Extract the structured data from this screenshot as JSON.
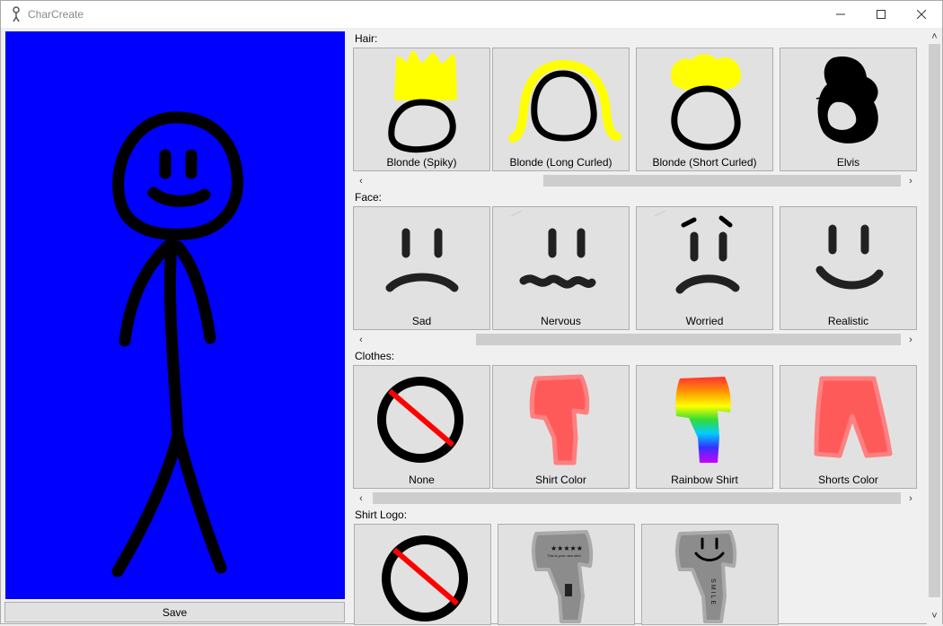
{
  "window": {
    "title": "CharCreate"
  },
  "preview": {
    "background_color": "#0000ff"
  },
  "save_label": "Save",
  "sections": {
    "hair": {
      "label": "Hair:",
      "items": [
        {
          "label": "Blonde (Spiky)"
        },
        {
          "label": "Blonde (Long Curled)"
        },
        {
          "label": "Blonde (Short Curled)"
        },
        {
          "label": "Elvis"
        }
      ]
    },
    "face": {
      "label": "Face:",
      "items": [
        {
          "label": "Sad"
        },
        {
          "label": "Nervous"
        },
        {
          "label": "Worried"
        },
        {
          "label": "Realistic"
        }
      ]
    },
    "clothes": {
      "label": "Clothes:",
      "items": [
        {
          "label": "None"
        },
        {
          "label": "Shirt Color"
        },
        {
          "label": "Rainbow Shirt"
        },
        {
          "label": "Shorts Color"
        }
      ]
    },
    "logo": {
      "label": "Shirt Logo:",
      "items": [
        {
          "label": ""
        },
        {
          "label": ""
        },
        {
          "label": ""
        }
      ],
      "logo_stars_text": "★★★★★",
      "logo_small_text": "This is your new shirt",
      "logo_smile_text": "SMILE"
    }
  },
  "colors": {
    "blonde": "#ffff00",
    "shirt": "#ff5a5a",
    "logo_shirt": "#8c8c8c",
    "no_symbol_red": "#ff0000"
  }
}
